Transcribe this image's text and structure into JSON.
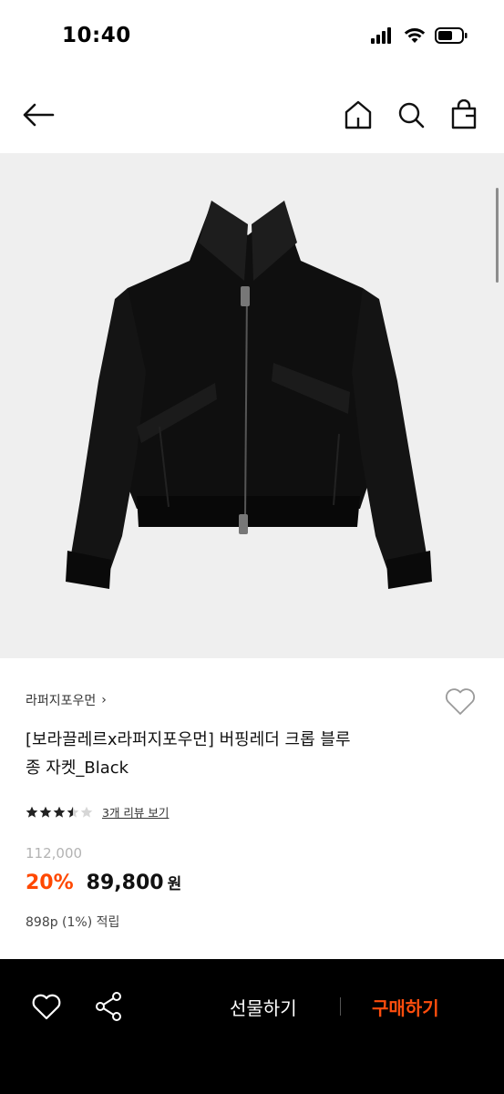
{
  "status_bar": {
    "time": "10:40"
  },
  "nav": {
    "icons": [
      "back-arrow-icon",
      "home-icon",
      "search-icon",
      "shopping-bag-icon"
    ]
  },
  "product": {
    "brand": "라퍼지포우먼",
    "brand_chevron": "›",
    "title_line1": "[보라끌레르x라퍼지포우먼] 버핑레더 크롭 블루",
    "title_line2": "종 자켓_Black",
    "rating": 3.5,
    "review_text": "3개 리뷰 보기",
    "original_price": "112,000",
    "discount": "20%",
    "sale_price": "89,800",
    "currency": "원",
    "points": "898p (1%) 적립"
  },
  "bottom_bar": {
    "gift_label": "선물하기",
    "buy_label": "구매하기",
    "icons": [
      "heart-icon",
      "share-icon"
    ]
  },
  "colors": {
    "accent": "#ff4800",
    "bar_background": "#000000"
  }
}
